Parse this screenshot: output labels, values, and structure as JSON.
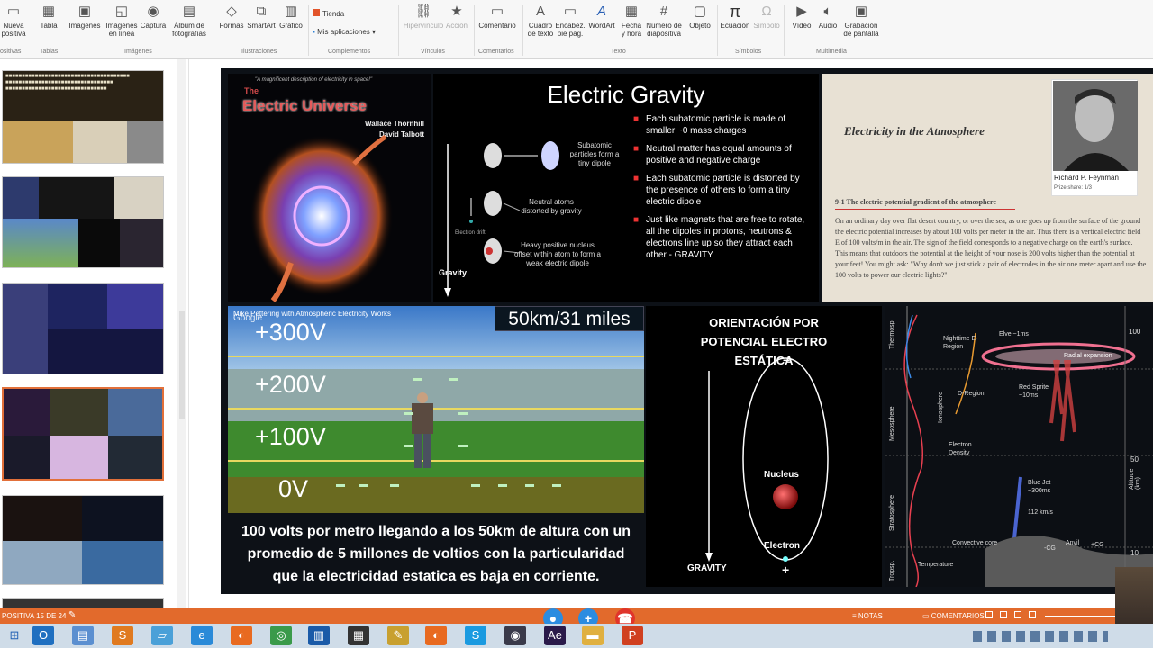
{
  "ribbon": {
    "buttons": [
      {
        "id": "nueva",
        "label": "Nueva",
        "sub": "positiva",
        "icon": "new-slide-icon"
      },
      {
        "id": "tabla",
        "label": "Tabla",
        "icon": "table-icon"
      },
      {
        "id": "imagenes",
        "label": "Imágenes",
        "icon": "picture-icon"
      },
      {
        "id": "imagenes-linea",
        "label": "Imágenes",
        "sub": "en línea",
        "icon": "online-picture-icon"
      },
      {
        "id": "captura",
        "label": "Captura",
        "icon": "camera-icon"
      },
      {
        "id": "album",
        "label": "Álbum de",
        "sub": "fotografías",
        "icon": "album-icon"
      },
      {
        "id": "formas",
        "label": "Formas",
        "icon": "shapes-icon"
      },
      {
        "id": "smartart",
        "label": "SmartArt",
        "icon": "smartart-icon"
      },
      {
        "id": "grafico",
        "label": "Gráfico",
        "icon": "chart-icon"
      },
      {
        "id": "hipervinculo",
        "label": "Hipervínculo",
        "icon": "link-icon"
      },
      {
        "id": "accion",
        "label": "Acción",
        "icon": "action-icon"
      },
      {
        "id": "comentario",
        "label": "Comentario",
        "icon": "comment-icon"
      },
      {
        "id": "cuadro-texto",
        "label": "Cuadro",
        "sub": "de texto",
        "icon": "textbox-icon"
      },
      {
        "id": "encabez",
        "label": "Encabez.",
        "sub": "pie pág.",
        "icon": "header-footer-icon"
      },
      {
        "id": "wordart",
        "label": "WordArt",
        "icon": "wordart-icon"
      },
      {
        "id": "fecha",
        "label": "Fecha",
        "sub": "y hora",
        "icon": "date-icon"
      },
      {
        "id": "numero",
        "label": "Número de",
        "sub": "diapositiva",
        "icon": "slide-number-icon"
      },
      {
        "id": "objeto",
        "label": "Objeto",
        "icon": "object-icon"
      },
      {
        "id": "ecuacion",
        "label": "Ecuación",
        "icon": "equation-icon"
      },
      {
        "id": "simbolo",
        "label": "Símbolo",
        "icon": "symbol-icon"
      },
      {
        "id": "video",
        "label": "Vídeo",
        "icon": "video-icon"
      },
      {
        "id": "audio",
        "label": "Audio",
        "icon": "audio-icon"
      },
      {
        "id": "grabacion",
        "label": "Grabación",
        "sub": "de pantalla",
        "icon": "screen-record-icon"
      }
    ],
    "store_label": "Tienda",
    "apps_label": "Mis aplicaciones",
    "groups": [
      "ositivas",
      "Tablas",
      "Imágenes",
      "Ilustraciones",
      "Complementos",
      "Vínculos",
      "Comentarios",
      "Texto",
      "Símbolos",
      "Multimedia"
    ]
  },
  "slide": {
    "book": {
      "top": "\"A magnificent description of electricity in space!\"",
      "the": "The",
      "title": "Electric Universe",
      "author1": "Wallace Thornhill",
      "author2": "David Talbott"
    },
    "gravity": {
      "title": "Electric Gravity",
      "bullets": [
        "Each subatomic particle is made of smaller ~0 mass charges",
        "Neutral matter has equal amounts of positive and negative charge",
        "Each subatomic particle is distorted by the presence of others to form a tiny electric dipole",
        "Just like magnets that are free to rotate, all the dipoles in protons, neutrons & electrons line up so they attract each other - GRAVITY"
      ],
      "lbl_dipole": "Subatomic particles form a tiny dipole",
      "lbl_neutral": "Neutral atoms distorted by gravity",
      "lbl_nucleus": "Heavy positive nucleus offset within atom to form a weak electric dipole",
      "lbl_drift": "Electron drift",
      "lbl_gravity": "Gravity"
    },
    "feynman": {
      "heading": "Electricity in the Atmosphere",
      "section": "9-1 The electric potential gradient of the atmosphere",
      "name": "Richard P. Feynman",
      "share": "Prize share: 1/3",
      "body": "On an ordinary day over flat desert country, or over the sea, as one goes up from the surface of the ground the electric potential increases by about 100 volts per meter in the air. Thus there is a vertical electric field E of 100 volts/m in the air. The sign of the field corresponds to a negative charge on the earth's surface. This means that outdoors the potential at the height of your nose is 200 volts higher than the potential at your feet! You might ask: \"Why don't we just stick a pair of electrodes in the air one meter apart and use the 100 volts to power our electric lights?\""
    },
    "voltage": {
      "caption": "Mike Pettering with Atmospheric Electricity Works",
      "brand": "Google",
      "badge": "50km/31 miles",
      "levels": [
        "+300V",
        "+200V",
        "+100V",
        "0V"
      ],
      "text": "100 volts por metro llegando a los 50km de altura con un promedio de 5 millones de voltios con la particularidad que la electricidad estatica es baja en corriente."
    },
    "orbit": {
      "title": "ORIENTACIÓN POR POTENCIAL ELECTRO ESTÁTICA",
      "nucleus": "Nucleus",
      "electron": "Electron",
      "gravity": "GRAVITY",
      "minus": "−",
      "plus": "+"
    },
    "atmos": {
      "layers": [
        "Thermosp.",
        "Mesosphere",
        "Stratosphere",
        "Tropsp."
      ],
      "ionosphere": "Ionosphere",
      "nighttime": "Nighttime E-Region",
      "d_region": "D-Region",
      "electron_density": "Electron Density",
      "temperature": "Temperature",
      "elve": "Elve ~1ms",
      "halo": "Radial expansion",
      "red_sprite": "Red Sprite ~10ms",
      "blue_jet": "Blue Jet ~300ms",
      "speed": "112 km/s",
      "convective": "Convective core",
      "anvil": "Anvil",
      "neg_cg": "-CG",
      "pos_cg": "+CG",
      "axis_label": "Altitude (km)",
      "ticks": [
        "100",
        "50",
        "10"
      ]
    }
  },
  "status": {
    "slide_info": "POSITIVA 15 DE 24",
    "notes": "NOTAS",
    "comments": "COMENTARIOS"
  },
  "taskbar": {
    "icons": [
      "windows-icon",
      "outlook-icon",
      "files-icon",
      "sublime-icon",
      "notes-icon",
      "ie-icon",
      "firefox-icon",
      "chrome-icon",
      "vmware-icon",
      "clapper-icon",
      "pen-icon",
      "firefox-icon-2",
      "skype-icon",
      "obs-icon",
      "after-effects-icon",
      "folder-icon",
      "powerpoint-icon"
    ]
  }
}
